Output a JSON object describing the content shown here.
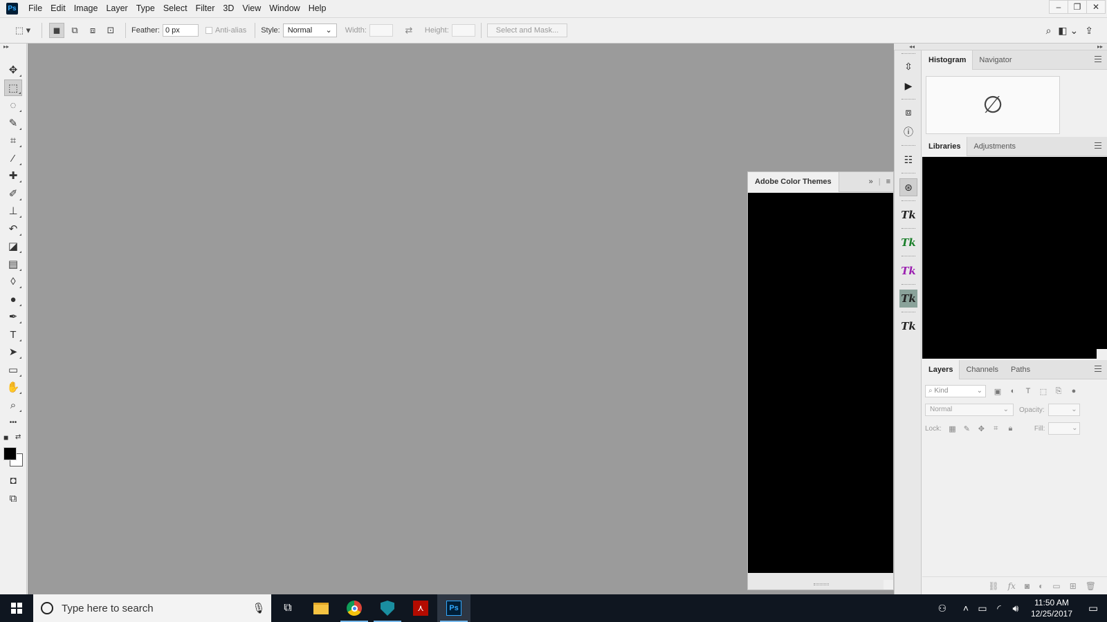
{
  "app": {
    "logo": "Ps",
    "menu": [
      "File",
      "Edit",
      "Image",
      "Layer",
      "Type",
      "Select",
      "Filter",
      "3D",
      "View",
      "Window",
      "Help"
    ],
    "window_controls": {
      "minimize": "–",
      "restore": "❐",
      "close": "✕"
    }
  },
  "options": {
    "feather_label": "Feather:",
    "feather_value": "0 px",
    "antialias_label": "Anti-alias",
    "style_label": "Style:",
    "style_value": "Normal",
    "width_label": "Width:",
    "height_label": "Height:",
    "select_mask_label": "Select and Mask..."
  },
  "tools": [
    {
      "name": "move-tool",
      "glyph": "✥"
    },
    {
      "name": "rectangular-marquee-tool",
      "glyph": "⬚"
    },
    {
      "name": "lasso-tool",
      "glyph": "◌"
    },
    {
      "name": "quick-selection-tool",
      "glyph": "✎"
    },
    {
      "name": "crop-tool",
      "glyph": "⌗"
    },
    {
      "name": "eyedropper-tool",
      "glyph": "⁄"
    },
    {
      "name": "healing-brush-tool",
      "glyph": "✚"
    },
    {
      "name": "brush-tool",
      "glyph": "✐"
    },
    {
      "name": "clone-stamp-tool",
      "glyph": "⊥"
    },
    {
      "name": "history-brush-tool",
      "glyph": "↶"
    },
    {
      "name": "eraser-tool",
      "glyph": "◪"
    },
    {
      "name": "gradient-tool",
      "glyph": "▤"
    },
    {
      "name": "blur-tool",
      "glyph": "◊"
    },
    {
      "name": "dodge-tool",
      "glyph": "●"
    },
    {
      "name": "pen-tool",
      "glyph": "✒"
    },
    {
      "name": "type-tool",
      "glyph": "T"
    },
    {
      "name": "path-selection-tool",
      "glyph": "➤"
    },
    {
      "name": "rectangle-tool",
      "glyph": "▭"
    },
    {
      "name": "hand-tool",
      "glyph": "✋"
    },
    {
      "name": "zoom-tool",
      "glyph": "⌕"
    },
    {
      "name": "more-tools",
      "glyph": "•••"
    }
  ],
  "colors": {
    "foreground": "#000000",
    "background": "#ffffff",
    "canvas": "#9b9b9b",
    "taskbar": "#0f1620"
  },
  "color_themes_panel": {
    "title": "Adobe Color Themes"
  },
  "dock_icons": [
    "history-icon",
    "actions-icon",
    "3d-icon",
    "info-icon",
    "properties-icon",
    "clone-source-icon",
    "tk-panel-1-icon",
    "tk-panel-2-icon",
    "tk-panel-3-icon",
    "tk-panel-4-icon",
    "tk-panel-5-icon"
  ],
  "dock_tk_label": "Tk",
  "panels": {
    "histogram": {
      "tabs": [
        "Histogram",
        "Navigator"
      ],
      "empty_glyph": "∅"
    },
    "libraries": {
      "tabs": [
        "Libraries",
        "Adjustments"
      ]
    },
    "layers": {
      "tabs": [
        "Layers",
        "Channels",
        "Paths"
      ],
      "kind_placeholder": "Kind",
      "blend_mode": "Normal",
      "opacity_label": "Opacity:",
      "lock_label": "Lock:",
      "fill_label": "Fill:"
    }
  },
  "taskbar": {
    "search_placeholder": "Type here to search",
    "time": "11:50 AM",
    "date": "12/25/2017"
  }
}
